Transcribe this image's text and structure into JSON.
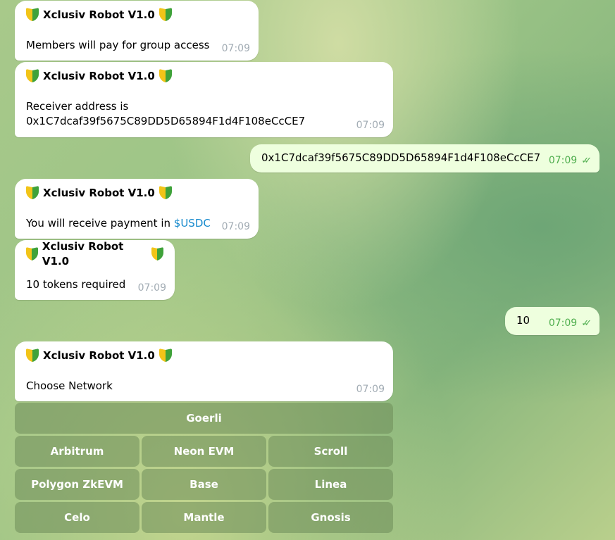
{
  "messages": [
    {
      "sender": "Xclusiv Robot V1.0",
      "text": "Members will pay for group access",
      "time": "07:09"
    },
    {
      "sender": "Xclusiv Robot V1.0",
      "text": "Receiver address is\n0x1C7dcaf39f5675C89DD5D65894F1d4F108eCcCE7",
      "time": "07:09"
    },
    {
      "text": "0x1C7dcaf39f5675C89DD5D65894F1d4F108eCcCE7",
      "time": "07:09",
      "status": "read"
    },
    {
      "sender": "Xclusiv Robot V1.0",
      "text": "You will receive payment in ",
      "link": "$USDC",
      "time": "07:09"
    },
    {
      "sender": "Xclusiv Robot V1.0",
      "text": "10 tokens required",
      "time": "07:09"
    },
    {
      "text": "10",
      "time": "07:09",
      "status": "read"
    },
    {
      "sender": "Xclusiv Robot V1.0",
      "text": "Choose Network",
      "time": "07:09"
    }
  ],
  "keyboard": {
    "rows": [
      [
        "Goerli"
      ],
      [
        "Arbitrum",
        "Neon EVM",
        "Scroll"
      ],
      [
        "Polygon ZkEVM",
        "Base",
        "Linea"
      ],
      [
        "Celo",
        "Mantle",
        "Gnosis"
      ]
    ]
  },
  "colors": {
    "incoming_bubble": "#ffffff",
    "outgoing_bubble": "#eeffde",
    "outgoing_time": "#4fae4e",
    "link": "#168acd",
    "keyboard_button": "#6e8c5a"
  },
  "icons": {
    "badge": "beginner-badge-icon",
    "read_status": "double-check-icon"
  }
}
